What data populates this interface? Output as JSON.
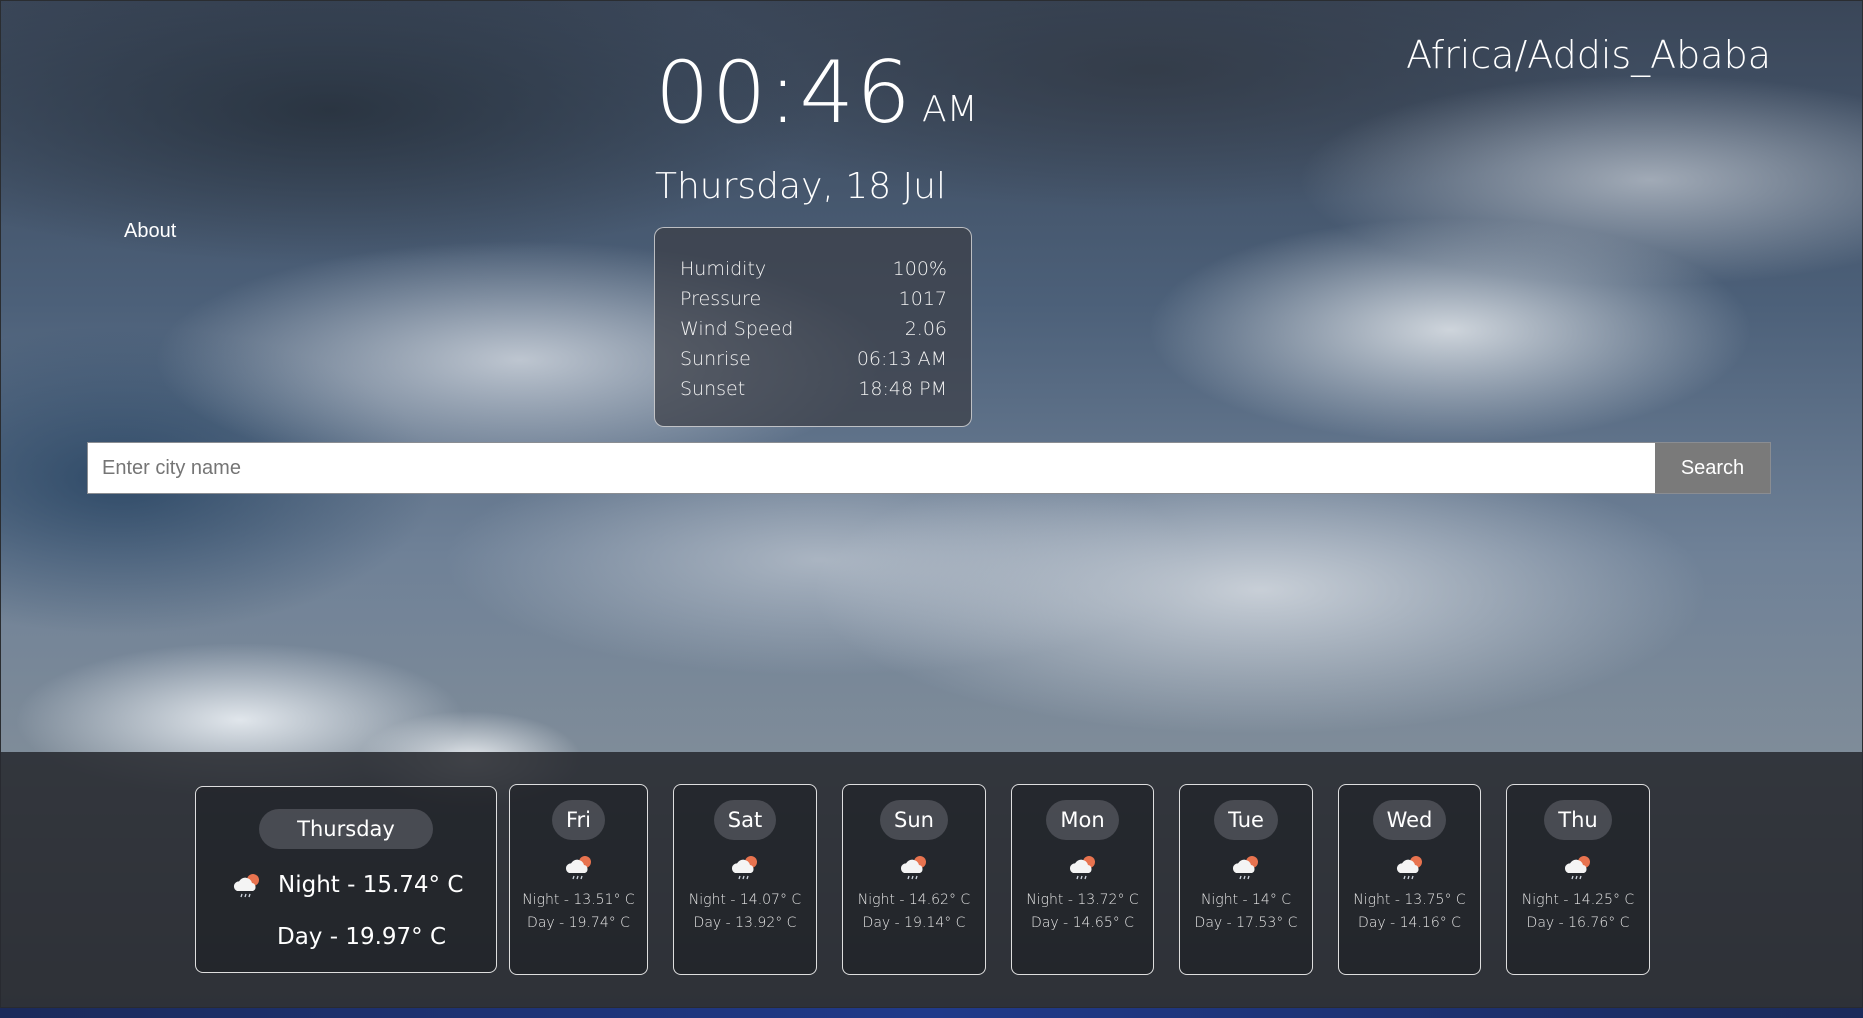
{
  "header": {
    "time": "00:46",
    "ampm": "AM",
    "date": "Thursday, 18 Jul",
    "timezone": "Africa/Addis_Ababa"
  },
  "nav": {
    "about_label": "About"
  },
  "details": {
    "rows": [
      {
        "label": "Humidity",
        "value": "100%"
      },
      {
        "label": "Pressure",
        "value": "1017"
      },
      {
        "label": "Wind Speed",
        "value": "2.06"
      },
      {
        "label": "Sunrise",
        "value": "06:13 AM"
      },
      {
        "label": "Sunset",
        "value": "18:48 PM"
      }
    ]
  },
  "search": {
    "placeholder": "Enter city name",
    "value": "",
    "button_label": "Search"
  },
  "forecast": {
    "today": {
      "day": "Thursday",
      "night": "Night - 15.74° C",
      "daytime": "Day - 19.97° C",
      "icon": "cloud-rain-sun-icon"
    },
    "days": [
      {
        "day": "Fri",
        "night": "Night - 13.51° C",
        "daytime": "Day - 19.74° C",
        "icon": "cloud-rain-sun-icon"
      },
      {
        "day": "Sat",
        "night": "Night - 14.07° C",
        "daytime": "Day - 13.92° C",
        "icon": "cloud-rain-sun-icon"
      },
      {
        "day": "Sun",
        "night": "Night - 14.62° C",
        "daytime": "Day - 19.14° C",
        "icon": "cloud-rain-sun-icon"
      },
      {
        "day": "Mon",
        "night": "Night - 13.72° C",
        "daytime": "Day - 14.65° C",
        "icon": "cloud-rain-sun-icon"
      },
      {
        "day": "Tue",
        "night": "Night - 14° C",
        "daytime": "Day - 17.53° C",
        "icon": "cloud-rain-sun-icon"
      },
      {
        "day": "Wed",
        "night": "Night - 13.75° C",
        "daytime": "Day - 14.16° C",
        "icon": "cloud-rain-sun-icon"
      },
      {
        "day": "Thu",
        "night": "Night - 14.25° C",
        "daytime": "Day - 16.76° C",
        "icon": "cloud-rain-sun-icon"
      }
    ]
  },
  "colors": {
    "sun": "#e8734f",
    "cloud": "#f4f4f4",
    "search_button": "#7a7a7a"
  }
}
